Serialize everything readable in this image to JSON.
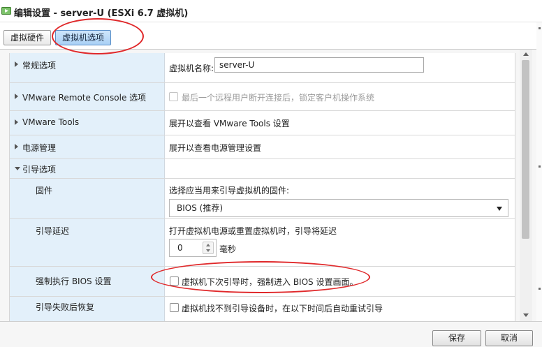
{
  "window": {
    "title": "编辑设置 - server-U (ESXi 6.7 虚拟机)"
  },
  "tabs": [
    {
      "label": "虚拟硬件",
      "active": false
    },
    {
      "label": "虚拟机选项",
      "active": true
    }
  ],
  "sections": {
    "general": {
      "label": "常规选项",
      "vm_name_label": "虚拟机名称:",
      "vm_name_value": "server-U"
    },
    "vmrc": {
      "label": "VMware Remote Console 选项",
      "lock_option": "最后一个远程用户断开连接后，锁定客户机操作系统",
      "lock_checked": false,
      "lock_disabled": true
    },
    "tools": {
      "label": "VMware Tools",
      "desc": "展开以查看 VMware Tools 设置"
    },
    "power": {
      "label": "电源管理",
      "desc": "展开以查看电源管理设置"
    },
    "boot": {
      "label": "引导选项",
      "firmware_label": "固件",
      "firmware_desc": "选择应当用来引导虚拟机的固件:",
      "firmware_value": "BIOS (推荐)",
      "delay_label": "引导延迟",
      "delay_desc": "打开虚拟机电源或重置虚拟机时，引导将延迟",
      "delay_value": "0",
      "delay_unit": "毫秒",
      "force_bios_label": "强制执行 BIOS 设置",
      "force_bios_option": "虚拟机下次引导时，强制进入 BIOS 设置画面。",
      "force_bios_checked": false,
      "failure_label": "引导失败后恢复",
      "failure_option": "虚拟机找不到引导设备时，在以下时间后自动重试引导",
      "failure_checked": false
    }
  },
  "footer": {
    "save_label": "保存",
    "cancel_label": "取消"
  },
  "colors": {
    "left_column_bg": "#e3f0fa",
    "active_tab_bg": "#a9d0f5",
    "annotation_red": "#e0282a"
  }
}
